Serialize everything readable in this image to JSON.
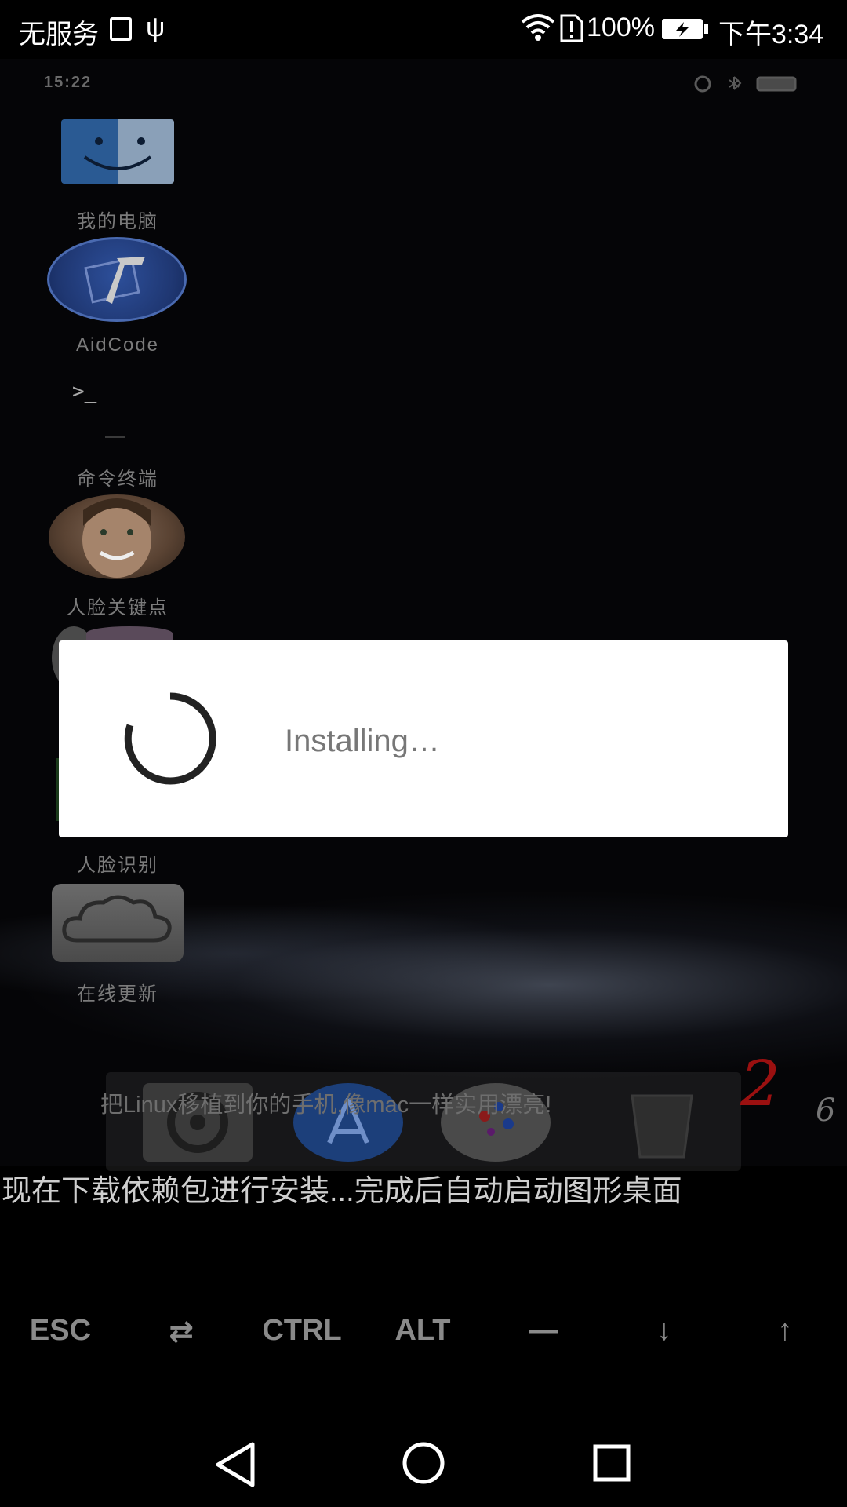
{
  "status_bar": {
    "carrier": "无服务",
    "usb_glyph": "ψ",
    "battery_percent": "100%",
    "time": "下午3:34",
    "icons": [
      "sd-card-icon",
      "usb-icon",
      "wifi-icon",
      "sim-alert-icon",
      "battery-charging-icon"
    ]
  },
  "inner_status": {
    "time": "15:22"
  },
  "desktop": {
    "icons": [
      {
        "label": "我的电脑",
        "icon": "finder-icon"
      },
      {
        "label": "AidCode",
        "icon": "xcode-hammer-icon"
      },
      {
        "label": "命令终端",
        "icon": "terminal-icon",
        "glyph": ">_"
      },
      {
        "label": "人脸关键点",
        "icon": "face-icon"
      },
      {
        "label": "人脸识别",
        "icon": "face-recognition-icon"
      },
      {
        "label": "在线更新",
        "icon": "cloud-icon"
      }
    ]
  },
  "banner": {
    "subtitle": "把Linux移植到你的手机,像mac一样实用漂亮!",
    "big_number": "2",
    "page_number": "6"
  },
  "terminal": {
    "line": "现在下载依赖包进行安装...完成后自动启动图形桌面"
  },
  "dialog": {
    "message": "Installing…"
  },
  "extra_keys": [
    "ESC",
    "⇄",
    "CTRL",
    "ALT",
    "—",
    "↓",
    "↑"
  ],
  "navbar": {
    "icons": [
      "back-icon",
      "home-icon",
      "recents-icon"
    ]
  }
}
